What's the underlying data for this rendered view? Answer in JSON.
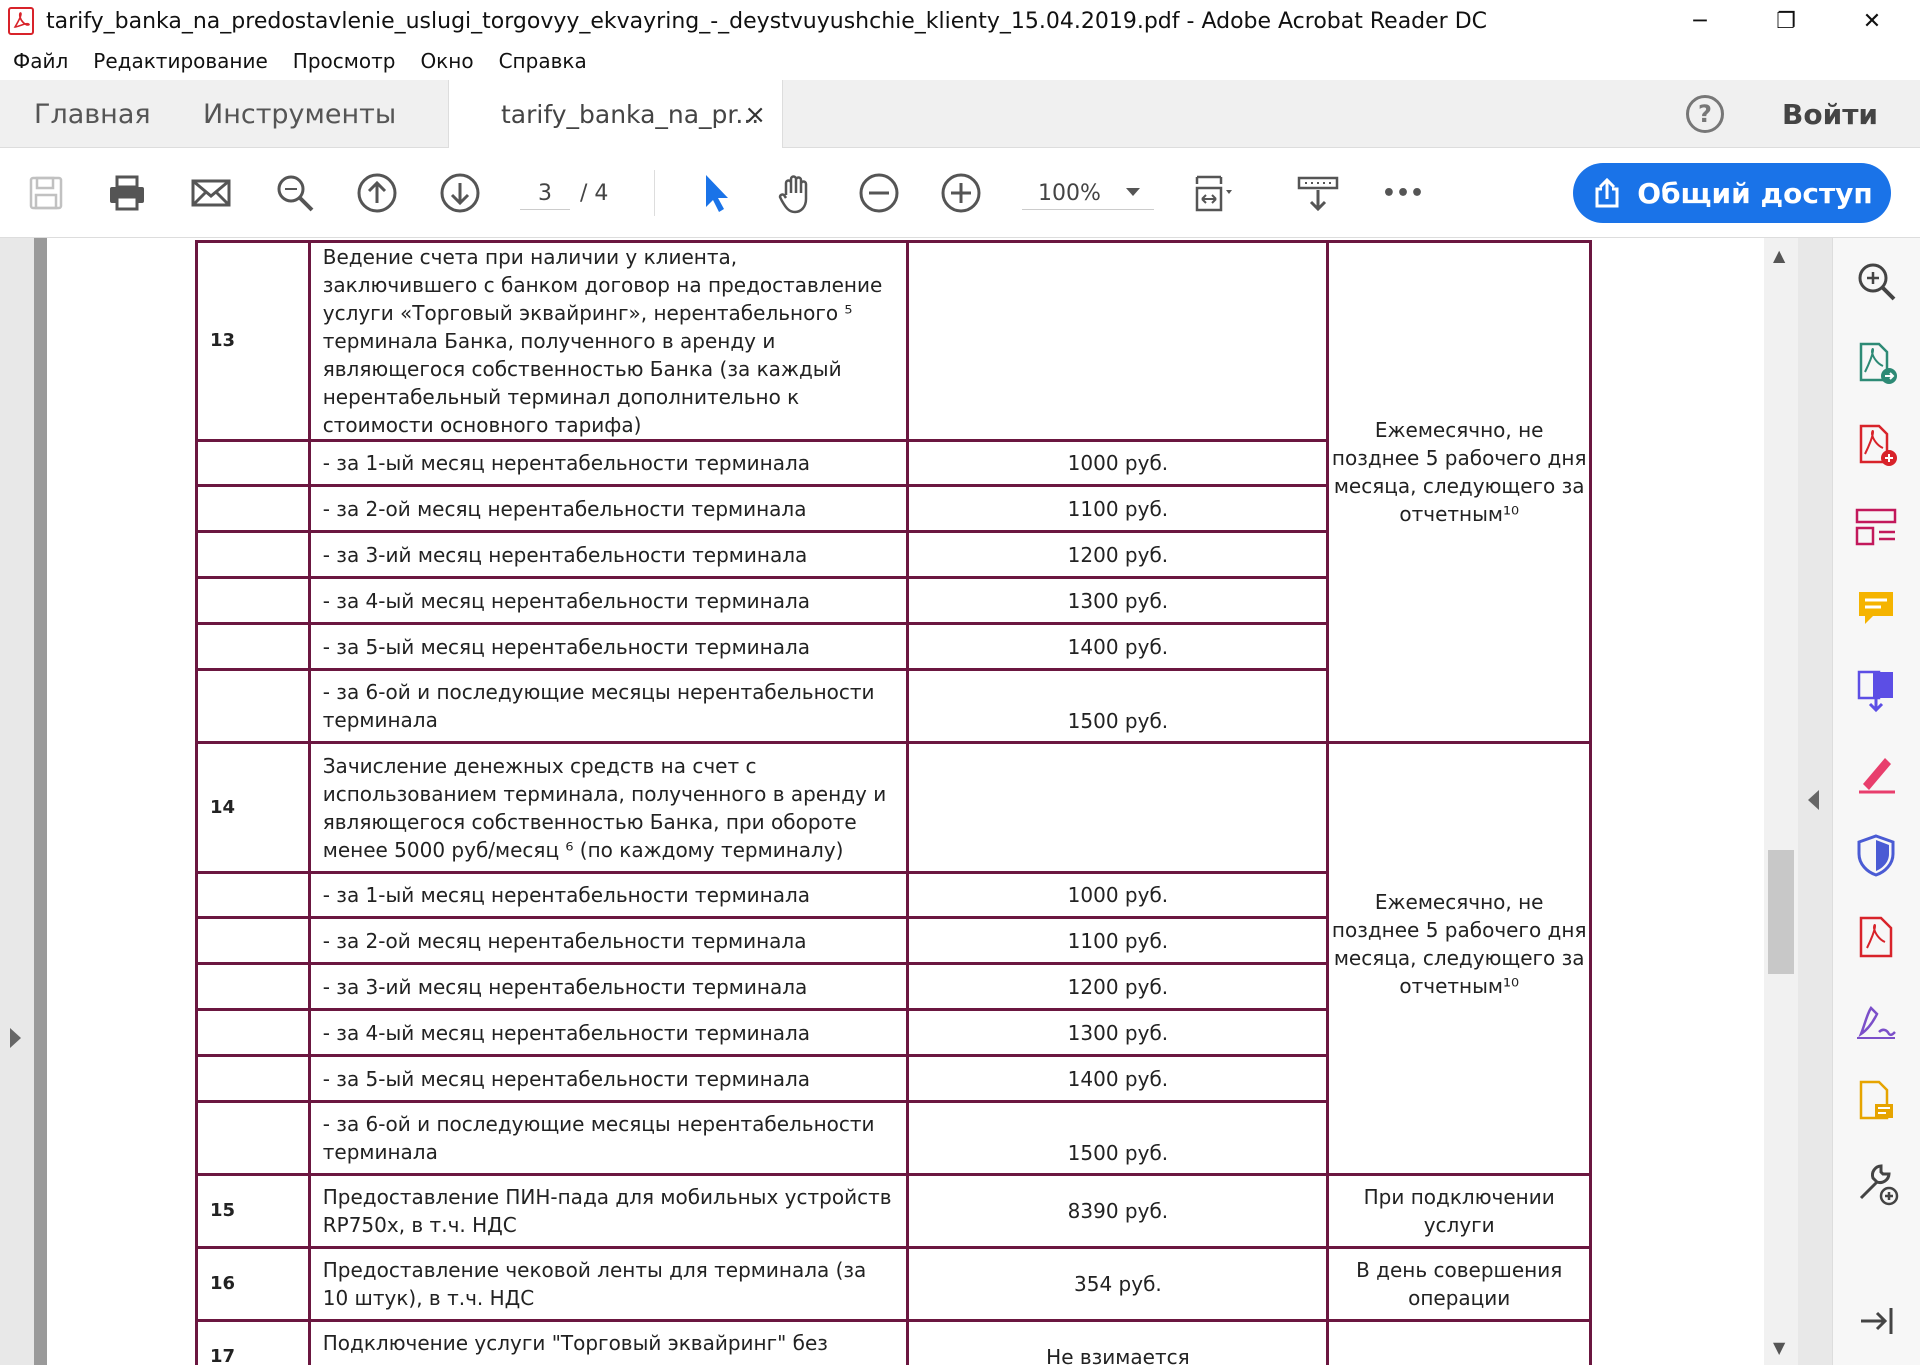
{
  "window": {
    "title": "tarify_banka_na_predostavlenie_uslugi_torgovyy_ekvayring_-_deystvuyushchie_klienty_15.04.2019.pdf - Adobe Acrobat Reader DC",
    "minimize": "─",
    "restore": "❐",
    "close": "✕"
  },
  "menu": [
    "Файл",
    "Редактирование",
    "Просмотр",
    "Окно",
    "Справка"
  ],
  "tabs": {
    "home": "Главная",
    "tools": "Инструменты",
    "document": "tarify_banka_na_pr...",
    "close": "×",
    "help": "?",
    "login": "Войти"
  },
  "toolbar": {
    "page_current": "3",
    "page_total": "/ 4",
    "zoom": "100%",
    "more": "•••",
    "share": "Общий доступ",
    "icons": [
      "save-icon",
      "print-icon",
      "email-icon",
      "search-icon",
      "prev-page-icon",
      "next-page-icon",
      "select-cursor-icon",
      "hand-icon",
      "zoom-out-icon",
      "zoom-in-icon",
      "fit-page-icon",
      "scroll-mode-icon",
      "more-icon"
    ]
  },
  "sidebar_icons": [
    "enhance-scans-icon",
    "export-pdf-icon",
    "create-pdf-icon",
    "organize-pages-icon",
    "comment-icon",
    "combine-files-icon",
    "fill-sign-icon",
    "protect-icon",
    "pdf-icon",
    "sign-icon",
    "send-review-icon",
    "tools-more-icon",
    "collapse-panel-icon"
  ],
  "accent_colors": {
    "share_button": "#1a73e8",
    "table_border": "#6b1740"
  },
  "table": {
    "rows": [
      {
        "num": "13",
        "desc": "Ведение счета при наличии у клиента, заключившего с банком договор на предоставление услуги «Торговый эквайринг», нерентабельного ⁵ терминала Банка, полученного в аренду и являющегося собственностью Банка (за каждый нерентабельный терминал дополнительно к стоимости основного тарифа)",
        "price": ""
      },
      {
        "num": "",
        "desc": "- за 1-ый месяц нерентабельности терминала",
        "price": "1000 руб."
      },
      {
        "num": "",
        "desc": " - за 2-ой месяц нерентабельности терминала",
        "price": "1100 руб."
      },
      {
        "num": "",
        "desc": " - за 3-ий месяц нерентабельности терминала",
        "price": "1200 руб."
      },
      {
        "num": "",
        "desc": " - за 4-ый месяц нерентабельности терминала",
        "price": "1300 руб."
      },
      {
        "num": "",
        "desc": " - за 5-ый месяц нерентабельности терминала",
        "price": "1400 руб."
      },
      {
        "num": "",
        "desc": " - за 6-ой и последующие месяцы нерентабельности терминала",
        "price": "1500 руб."
      },
      {
        "num": "14",
        "desc": "Зачисление денежных средств на счет с использованием терминала, полученного в аренду и являющегося собственностью Банка, при обороте менее 5000 руб/месяц ⁶ (по каждому терминалу)",
        "price": ""
      },
      {
        "num": "",
        "desc": "- за 1-ый месяц нерентабельности терминала",
        "price": "1000 руб."
      },
      {
        "num": "",
        "desc": " - за 2-ой месяц нерентабельности терминала",
        "price": "1100 руб."
      },
      {
        "num": "",
        "desc": " - за 3-ий месяц нерентабельности терминала",
        "price": "1200 руб."
      },
      {
        "num": "",
        "desc": " - за 4-ый месяц нерентабельности терминала",
        "price": "1300 руб."
      },
      {
        "num": "",
        "desc": " - за 5-ый месяц нерентабельности терминала",
        "price": "1400 руб."
      },
      {
        "num": "",
        "desc": " - за 6-ой и последующие месяцы нерентабельности терминала",
        "price": "1500 руб."
      },
      {
        "num": "15",
        "desc": "Предоставление ПИН-пада для мобильных устройств RP750x, в т.ч. НДС",
        "price": "8390 руб.",
        "term": "При подключении услуги"
      },
      {
        "num": "16",
        "desc": "Предоставление чековой ленты для терминала (за 10 штук), в т.ч. НДС",
        "price": "354 руб.",
        "term": "В день совершения операции"
      },
      {
        "num": "17",
        "desc": "Подключение услуги \"Торговый эквайринг\" без технологического сопровождения",
        "price": "Не взимается",
        "term": ""
      }
    ],
    "terms": {
      "group13": "Ежемесячно, не позднее 5 рабочего дня месяца, следующего за отчетным¹⁰",
      "group14": "Ежемесячно, не позднее 5 рабочего дня месяца, следующего за отчетным¹⁰"
    }
  }
}
